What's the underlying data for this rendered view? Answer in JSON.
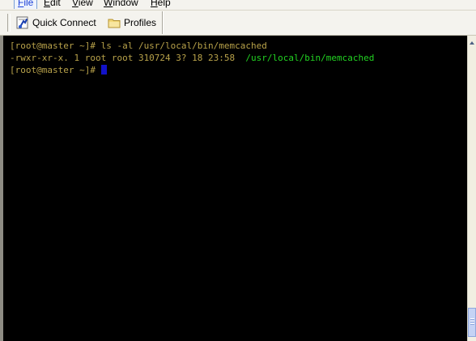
{
  "menu": {
    "items": [
      {
        "mnemonic": "F",
        "rest": "ile"
      },
      {
        "mnemonic": "E",
        "rest": "dit"
      },
      {
        "mnemonic": "V",
        "rest": "iew"
      },
      {
        "mnemonic": "W",
        "rest": "indow"
      },
      {
        "mnemonic": "H",
        "rest": "elp"
      }
    ]
  },
  "toolbar": {
    "quick_connect_label": "Quick Connect",
    "profiles_label": "Profiles",
    "quick_connect_icon": "quick-connect-icon",
    "profiles_icon": "folder-icon"
  },
  "terminal": {
    "line1": "[root@master ~]# ls -al /usr/local/bin/memcached",
    "line2_prefix": "-rwxr-xr-x. 1 root root 310724 3? 18 23:58  ",
    "line2_path": "/usr/local/bin/memcached",
    "line3": "[root@master ~]# ",
    "text_color": "#b8a24a",
    "path_color": "#22d322",
    "cursor_color": "#1212c8",
    "background": "#000000"
  }
}
